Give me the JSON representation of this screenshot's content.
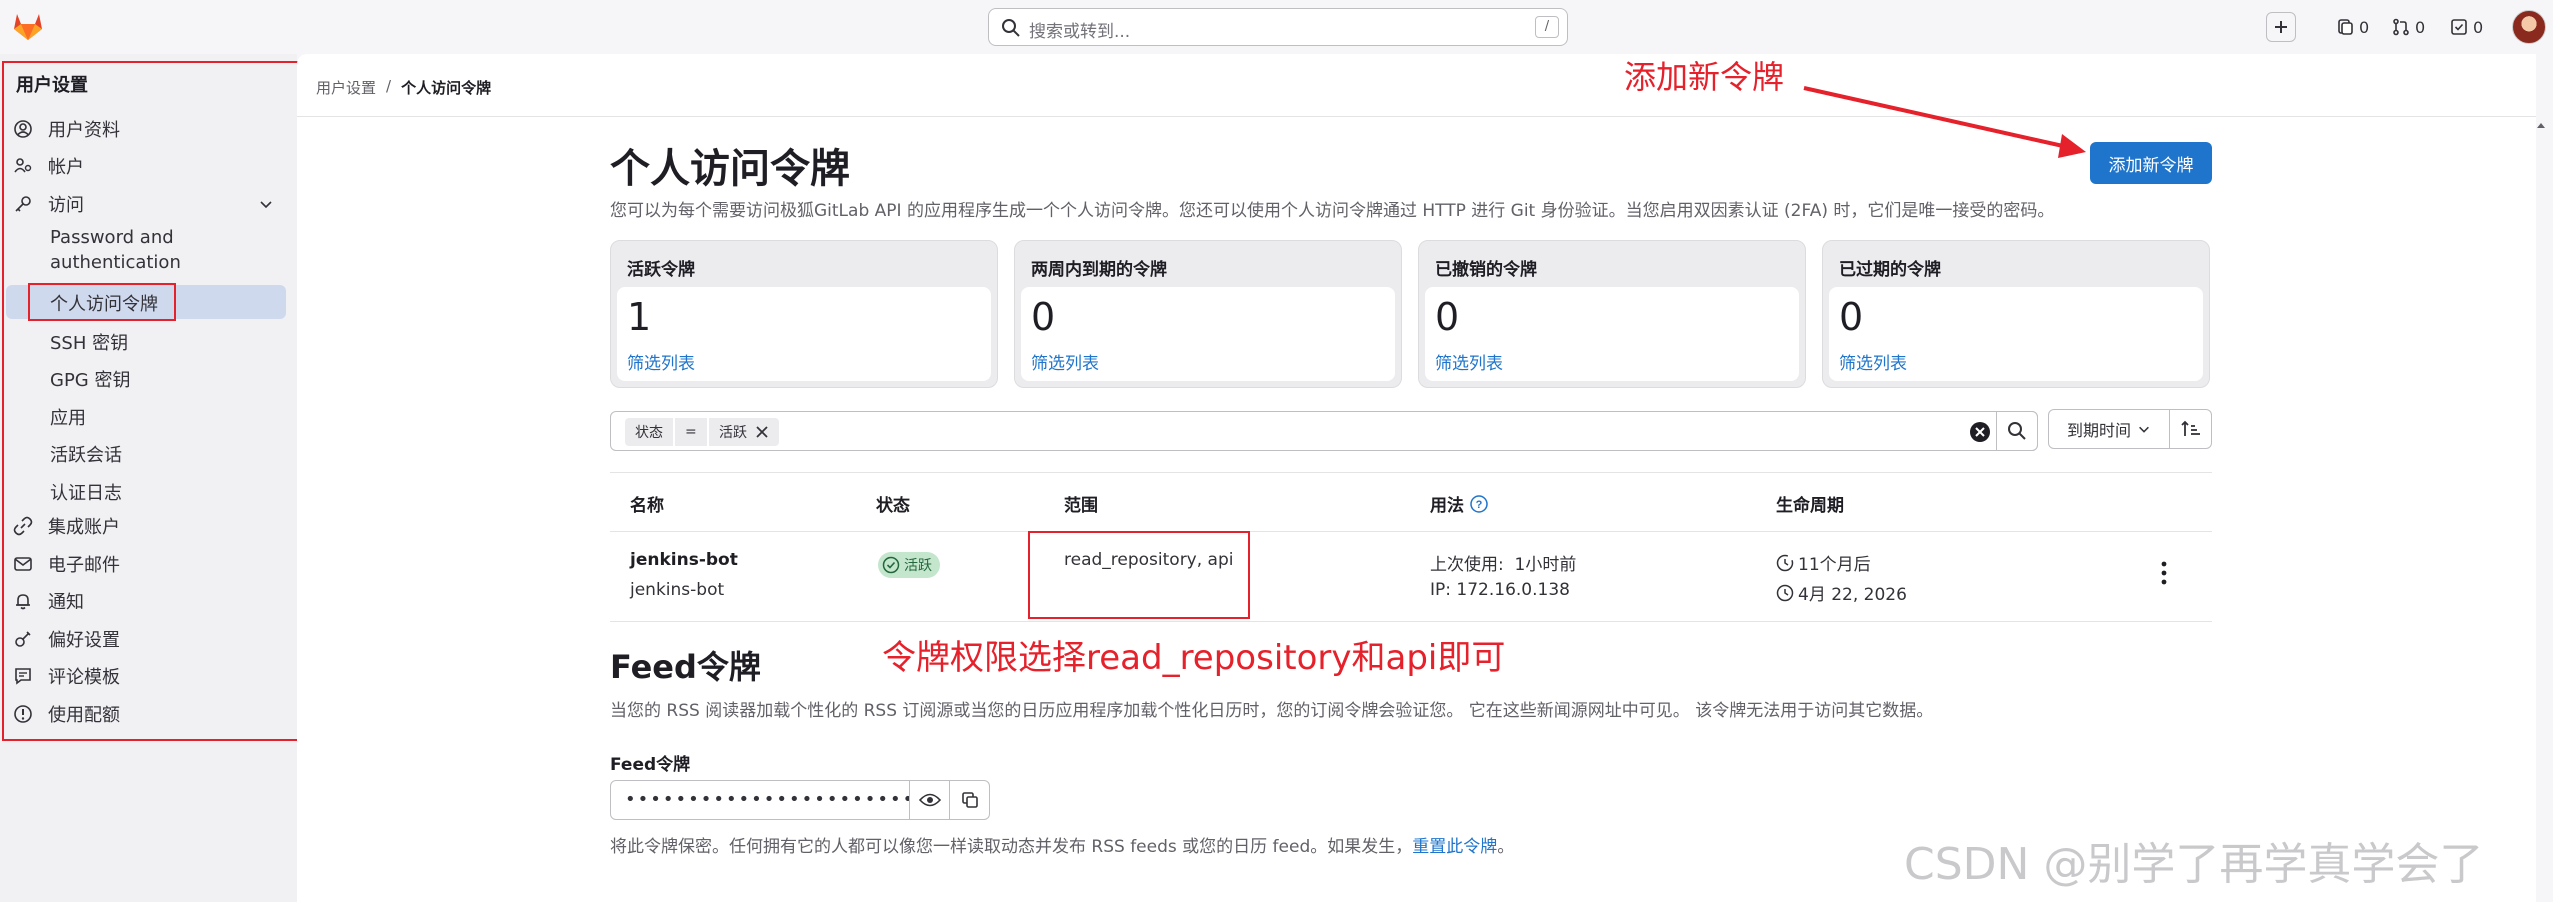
{
  "topbar": {
    "search_placeholder": "搜索或转到...",
    "search_shortcut": "/",
    "issues_count": "0",
    "mr_count": "0",
    "todo_count": "0"
  },
  "sidebar": {
    "title": "用户设置",
    "items": [
      {
        "label": "用户资料",
        "icon": "profile-icon"
      },
      {
        "label": "帐户",
        "icon": "account-icon"
      },
      {
        "label": "访问",
        "icon": "key-icon"
      },
      {
        "label": "集成账户",
        "icon": "link-icon"
      },
      {
        "label": "电子邮件",
        "icon": "mail-icon"
      },
      {
        "label": "通知",
        "icon": "bell-icon"
      },
      {
        "label": "偏好设置",
        "icon": "preferences-icon"
      },
      {
        "label": "评论模板",
        "icon": "comment-icon"
      },
      {
        "label": "使用配额",
        "icon": "quota-icon"
      }
    ],
    "access_sub": {
      "password_line1": "Password and",
      "password_line2": "authentication",
      "pat": "个人访问令牌",
      "ssh": "SSH 密钥",
      "gpg": "GPG 密钥",
      "apps": "应用",
      "sessions": "活跃会话",
      "auth_log": "认证日志"
    }
  },
  "breadcrumb": {
    "parent": "用户设置",
    "separator": "/",
    "current": "个人访问令牌"
  },
  "page": {
    "title": "个人访问令牌",
    "description": "您可以为每个需要访问极狐GitLab API 的应用程序生成一个个人访问令牌。您还可以使用个人访问令牌通过 HTTP 进行 Git 身份验证。当您启用双因素认证 (2FA) 时，它们是唯一接受的密码。",
    "add_button": "添加新令牌"
  },
  "stats": [
    {
      "label": "活跃令牌",
      "value": "1",
      "link": "筛选列表"
    },
    {
      "label": "两周内到期的令牌",
      "value": "0",
      "link": "筛选列表"
    },
    {
      "label": "已撤销的令牌",
      "value": "0",
      "link": "筛选列表"
    },
    {
      "label": "已过期的令牌",
      "value": "0",
      "link": "筛选列表"
    }
  ],
  "filter": {
    "token_key": "状态",
    "token_op": "=",
    "token_value": "活跃",
    "sort_label": "到期时间"
  },
  "table": {
    "headers": [
      "名称",
      "状态",
      "范围",
      "用法",
      "生命周期"
    ],
    "rows": [
      {
        "name": "jenkins-bot",
        "subname": "jenkins-bot",
        "status": "活跃",
        "scopes": "read_repository, api",
        "last_used_label": "上次使用:",
        "last_used": "1小时前",
        "ip_label": "IP:",
        "ip": "172.16.0.138",
        "expires_in": "11个月后",
        "expires_on": "4月 22, 2026"
      }
    ]
  },
  "feed": {
    "title": "Feed令牌",
    "description": "当您的 RSS 阅读器加载个性化的 RSS 订阅源或当您的日历应用程序加载个性化日历时，您的订阅令牌会验证您。 它在这些新闻源网址中可见。 该令牌无法用于访问其它数据。",
    "label": "Feed令牌",
    "masked_value": "••••••••••••••••••••••••••",
    "note": "将此令牌保密。任何拥有它的人都可以像您一样读取动态并发布 RSS feeds 或您的日历 feed。如果发生，",
    "reset_link": "重置此令牌",
    "note_end": "。"
  },
  "annotations": {
    "add_token": "添加新令牌",
    "scope_tip": "令牌权限选择read_repository和api即可",
    "annotation_color": "#e5212b"
  },
  "watermark": "CSDN @别学了再学真学会了",
  "colors": {
    "accent": "#1f75cb",
    "success_bg": "#c3e6cd",
    "success_text": "#24663b"
  }
}
